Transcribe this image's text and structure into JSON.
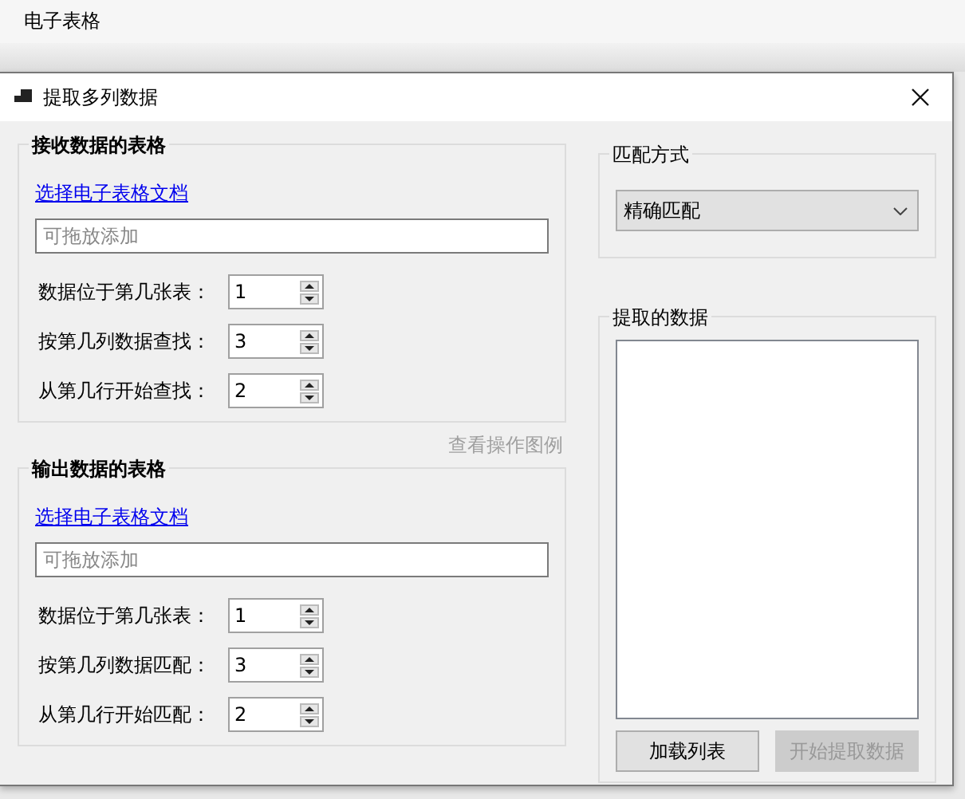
{
  "app_title": "电子表格",
  "dialog": {
    "title": "提取多列数据"
  },
  "groups": [
    {
      "title": "接收数据的表格",
      "link": "选择电子表格文档",
      "drop_placeholder": "可拖放添加",
      "spinners": [
        {
          "label": "数据位于第几张表：",
          "value": "1"
        },
        {
          "label": "按第几列数据查找：",
          "value": "3"
        },
        {
          "label": "从第几行开始查找：",
          "value": "2"
        }
      ]
    },
    {
      "title": "输出数据的表格",
      "link": "选择电子表格文档",
      "drop_placeholder": "可拖放添加",
      "spinners": [
        {
          "label": "数据位于第几张表：",
          "value": "1"
        },
        {
          "label": "按第几列数据匹配：",
          "value": "3"
        },
        {
          "label": "从第几行开始匹配：",
          "value": "2"
        }
      ]
    }
  ],
  "legend_link": {
    "label": "查看操作图例",
    "disabled": true
  },
  "match_group": {
    "title": "匹配方式",
    "value": "精确匹配"
  },
  "result_group": {
    "title": "提取的数据"
  },
  "buttons": [
    {
      "label": "加载列表",
      "disabled": false
    },
    {
      "label": "开始提取数据",
      "disabled": true
    }
  ]
}
